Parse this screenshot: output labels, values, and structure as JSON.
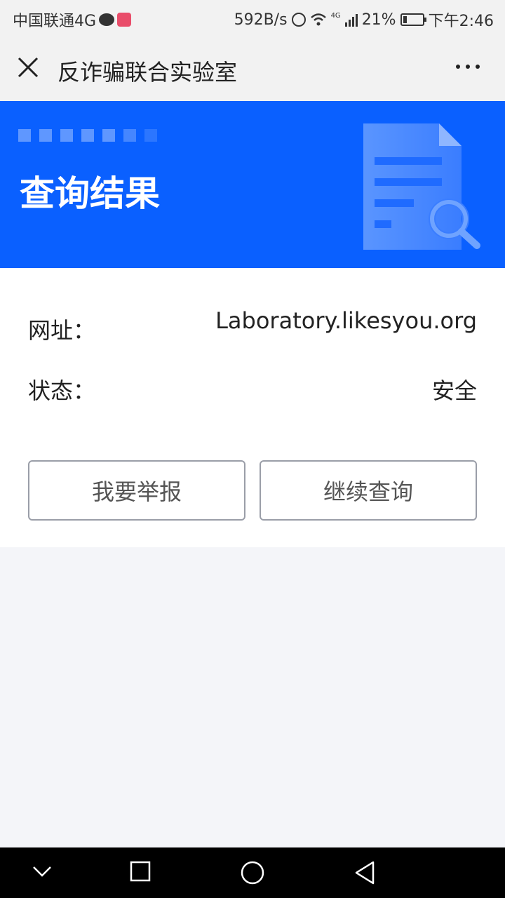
{
  "status_bar": {
    "carrier": "中国联通4G",
    "network_speed": "592B/s",
    "network_type": "4G",
    "battery_percent": "21%",
    "battery_level": 0.21,
    "time": "下午2:46"
  },
  "navbar": {
    "title": "反诈骗联合实验室"
  },
  "banner": {
    "title": "查询结果"
  },
  "result": {
    "url_label": "网址：",
    "url_value": "Laboratory.likesyou.org",
    "status_label": "状态：",
    "status_value": "安全"
  },
  "buttons": {
    "report": "我要举报",
    "continue": "继续查询"
  },
  "colors": {
    "brand_blue": "#0a60ff",
    "page_bg": "#f4f5f9",
    "nav_bg": "#f2f2f2"
  }
}
